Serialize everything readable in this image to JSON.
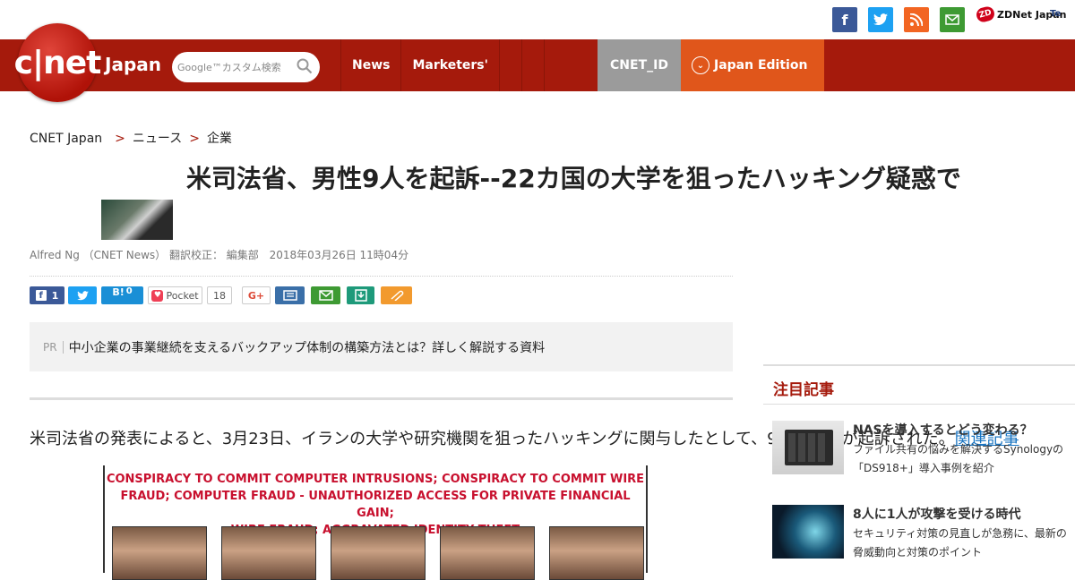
{
  "header": {
    "social_icons": [
      "facebook-icon",
      "twitter-icon",
      "rss-icon",
      "mail-icon"
    ],
    "partner_links": [
      "ZDNet Japan",
      "Te"
    ],
    "logo_text": "c|net",
    "logo_sub": "Japan",
    "search": {
      "placeholder": "Google™カスタム検索"
    },
    "nav": [
      "News",
      "Marketers'"
    ],
    "cnet_id": "CNET_ID",
    "edition": "Japan Edition"
  },
  "breadcrumb": [
    "CNET Japan",
    "ニュース",
    "企業"
  ],
  "article": {
    "title": "米司法省、男性9人を起訴--22カ国の大学を狙ったハッキング疑惑で",
    "byline": "Alfred Ng （CNET News） 翻訳校正： 編集部",
    "date": "2018年03月26日 11時04分",
    "share": {
      "facebook_count": "1",
      "hatena_count": "0",
      "pocket_label": "Pocket",
      "pocket_count": "18"
    },
    "pr_tag": "PR",
    "pr_text": "中小企業の事業継続を支えるバックアップ体制の構築方法とは？詳しく解説する資料",
    "lead_text": "米司法省の発表によると、3月23日、イランの大学や研究機関を狙ったハッキングに関与したとして、9人の男性が起訴された。",
    "lead_link": "関連記事",
    "poster_header": [
      "CONSPIRACY TO COMMIT COMPUTER INTRUSIONS; CONSPIRACY TO COMMIT WIRE",
      "FRAUD; COMPUTER FRAUD - UNAUTHORIZED ACCESS FOR PRIVATE FINANCIAL GAIN;",
      "WIRE FRAUD; AGGRAVATED IDENTITY THEFT"
    ]
  },
  "sidebar": {
    "heading": "注目記事",
    "items": [
      {
        "title": "NASを導入するとどう変わる？",
        "desc": "ファイル共有の悩みを解決するSynologyの「DS918+」導入事例を紹介"
      },
      {
        "title": "8人に1人が攻撃を受ける時代",
        "desc": "セキュリティ対策の見直しが急務に、最新の脅威動向と対策のポイント"
      }
    ]
  },
  "colors": {
    "brand_red": "#a51a0c",
    "edition_orange": "#e0561b",
    "cnetid_gray": "#9b9b9b",
    "link_blue": "#1a75c2"
  }
}
